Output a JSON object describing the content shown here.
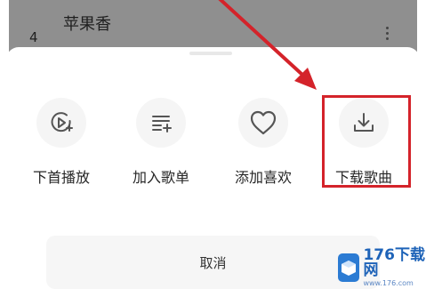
{
  "background_list": {
    "song_title": "苹果香",
    "track_number": "4"
  },
  "actions": [
    {
      "label": "下首播放",
      "icon": "play-next-icon"
    },
    {
      "label": "加入歌单",
      "icon": "add-to-playlist-icon"
    },
    {
      "label": "添加喜欢",
      "icon": "heart-icon"
    },
    {
      "label": "下载歌曲",
      "icon": "download-icon"
    }
  ],
  "cancel_label": "取消",
  "watermark": {
    "main": "176下载网",
    "sub": "www.176.com"
  },
  "colors": {
    "highlight": "#d4232a",
    "arrow": "#d4232a",
    "icon": "#555555",
    "watermark": "#1e63b8"
  }
}
